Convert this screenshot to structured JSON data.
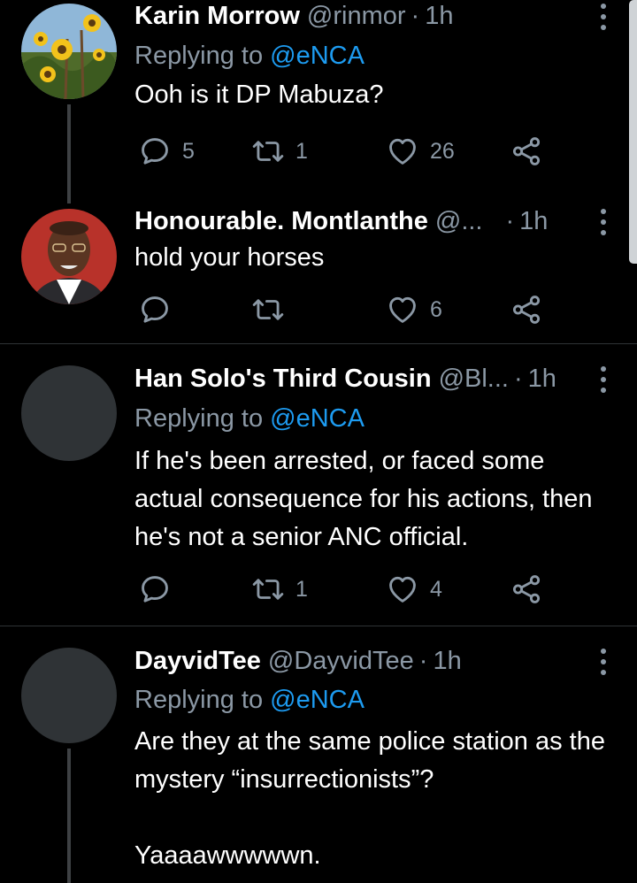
{
  "tweets": [
    {
      "name": "Karin Morrow",
      "handle": "@rinmor",
      "sep": "·",
      "time": "1h",
      "reply_prefix": "Replying to ",
      "reply_to": "@eNCA",
      "text": "Ooh is it DP Mabuza?",
      "reply_count": "5",
      "retweet_count": "1",
      "like_count": "26"
    },
    {
      "name": "Honourable. Montlanthe",
      "handle": "@...",
      "sep": "·",
      "time": "1h",
      "text": "hold your horses",
      "reply_count": "",
      "retweet_count": "",
      "like_count": "6"
    },
    {
      "name": "Han Solo's Third Cousin",
      "handle": "@Bl...",
      "sep": "·",
      "time": "1h",
      "reply_prefix": "Replying to ",
      "reply_to": "@eNCA",
      "text": "If he's been arrested, or faced some actual consequence for his actions, then he's not a senior ANC official.",
      "reply_count": "",
      "retweet_count": "1",
      "like_count": "4"
    },
    {
      "name": "DayvidTee",
      "handle": "@DayvidTee",
      "sep": "·",
      "time": "1h",
      "reply_prefix": "Replying to ",
      "reply_to": "@eNCA",
      "text": "Are they at the same police station as the mystery “insurrectionists”?\n\nYaaaawwwwwn.",
      "reply_count": "",
      "retweet_count": "",
      "like_count": ""
    }
  ],
  "icons": {
    "reply": "reply-icon",
    "retweet": "retweet-icon",
    "like": "heart-icon",
    "share": "share-icon",
    "more": "more-vertical-icon"
  },
  "colors": {
    "background": "#000000",
    "text": "#ffffff",
    "secondary": "#8b98a5",
    "mention": "#1d9bf0",
    "divider": "#2f3336"
  }
}
